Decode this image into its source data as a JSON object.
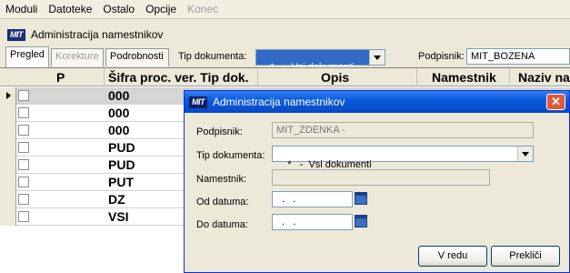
{
  "menu": {
    "items": [
      {
        "label": "Moduli",
        "disabled": false
      },
      {
        "label": "Datoteke",
        "disabled": false
      },
      {
        "label": "Ostalo",
        "disabled": false
      },
      {
        "label": "Opcije",
        "disabled": false
      },
      {
        "label": "Konec",
        "disabled": true
      }
    ]
  },
  "window": {
    "logo": "MIT",
    "title": "Administracija namestnikov"
  },
  "toolbar": {
    "tabs": [
      {
        "label": "Pregled",
        "active": true,
        "disabled": false
      },
      {
        "label": "Korekture",
        "active": false,
        "disabled": true
      },
      {
        "label": "Podrobnosti",
        "active": false,
        "disabled": false
      }
    ],
    "doc_type_label": "Tip dokumenta:",
    "doc_type_value": "*   -  Vsi dokumenti",
    "signer_label": "Podpisnik:",
    "signer_value": "MIT_BOZENA"
  },
  "grid": {
    "headers": {
      "p": "P",
      "code": "Šifra proc. ver. Tip dok.",
      "desc": "Opis",
      "deputy": "Namestnik",
      "name": "Naziv na"
    },
    "rows": [
      {
        "code": "000",
        "selected": true
      },
      {
        "code": "000",
        "selected": false
      },
      {
        "code": "000",
        "selected": false
      },
      {
        "code": "PUD",
        "selected": false
      },
      {
        "code": "PUD",
        "selected": false
      },
      {
        "code": "PUT",
        "selected": false
      },
      {
        "code": "DZ",
        "selected": false
      },
      {
        "code": "VSI",
        "selected": false
      }
    ]
  },
  "dialog": {
    "logo": "MIT",
    "title": "Administracija namestnikov",
    "close_glyph": "✕",
    "signer_label": "Podpisnik:",
    "signer_value": "MIT_ZDENKA -",
    "doc_type_label": "Tip dokumenta:",
    "doc_type_value": "*   -  Vsi dokumenti",
    "deputy_label": "Namestnik:",
    "deputy_value": "",
    "from_label": "Od datuma:",
    "from_value": "  .   .",
    "to_label": "Do datuma:",
    "to_value": "  .   .",
    "ok_label": "V redu",
    "cancel_label": "Prekliči"
  },
  "colors": {
    "accent": "#0a5cdc",
    "selection": "#316ac5",
    "close": "#e0573b"
  }
}
